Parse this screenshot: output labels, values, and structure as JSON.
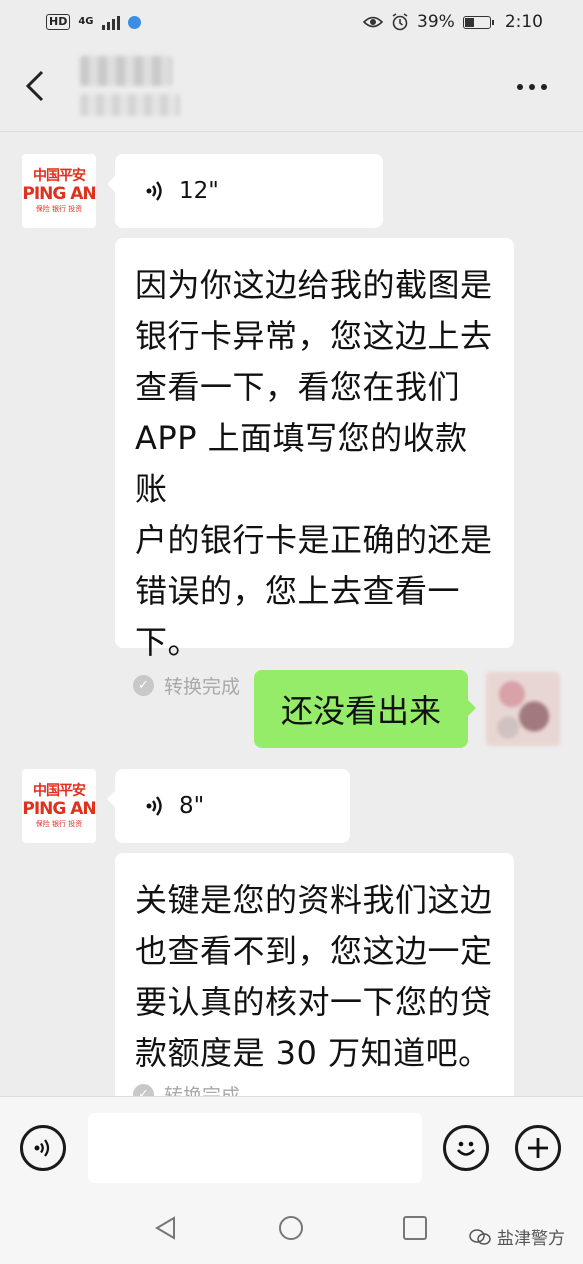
{
  "status_bar": {
    "network_badge": "HD",
    "network_type": "4G",
    "battery_percent": "39%",
    "battery_level": 0.39,
    "time": "2:10"
  },
  "nav": {
    "back_icon": "chevron-left-icon",
    "more_icon": "more-dots-icon"
  },
  "brand_avatar": {
    "cn_name": "中国平安",
    "en_name": "PING AN",
    "tagline": "保险 银行 投资"
  },
  "messages": [
    {
      "sender": "other",
      "type": "voice",
      "duration": "12\""
    },
    {
      "sender": "other",
      "type": "voice-text",
      "lines": [
        "因为你这边给我的截图是",
        "银行卡异常，您这边上去",
        "查看一下，看您在我们",
        "APP 上面填写您的收款账",
        "户的银行卡是正确的还是",
        "错误的，您上去查看一",
        "下。"
      ],
      "status": "转换完成"
    },
    {
      "sender": "me",
      "type": "text",
      "text": "还没看出来"
    },
    {
      "sender": "other",
      "type": "voice",
      "duration": "8\""
    },
    {
      "sender": "other",
      "type": "voice-text",
      "lines": [
        "关键是您的资料我们这边",
        "也查看不到，您这边一定",
        "要认真的核对一下您的贷",
        "款额度是 30 万知道吧。"
      ],
      "status": "转换完成"
    }
  ],
  "input_bar": {
    "voice_icon": "voice-mode-icon",
    "emoji_icon": "emoji-icon",
    "plus_icon": "plus-icon",
    "placeholder": ""
  },
  "system_nav": {
    "back_icon": "triangle-back-icon",
    "home_icon": "circle-home-icon",
    "recents_icon": "square-recents-icon"
  },
  "watermark": {
    "text": "盐津警方"
  },
  "colors": {
    "background": "#ededed",
    "my_bubble": "#95ec69",
    "other_bubble": "#ffffff",
    "brand_red": "#e0301e"
  }
}
